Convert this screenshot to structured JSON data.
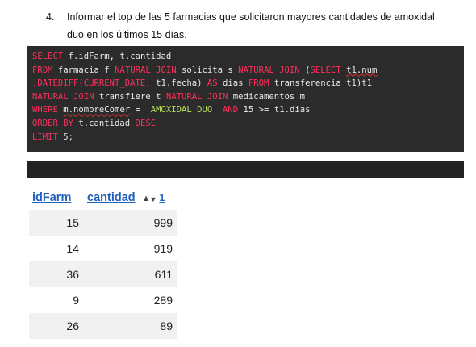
{
  "question": {
    "number": "4.",
    "line1": "Informar el top de las 5 farmacias que solicitaron mayores cantidades de amoxidal",
    "line2": "duo en los últimos 15 días."
  },
  "sql": [
    [
      {
        "t": "SELECT",
        "k": "kw"
      },
      {
        "t": " f.idFarm, t.cantidad"
      }
    ],
    [
      {
        "t": "FROM",
        "k": "kw"
      },
      {
        "t": " farmacia f "
      },
      {
        "t": "NATURAL JOIN",
        "k": "kw"
      },
      {
        "t": " solicita s "
      },
      {
        "t": "NATURAL JOIN",
        "k": "kw"
      },
      {
        "t": " ("
      },
      {
        "t": "SELECT",
        "k": "kw"
      },
      {
        "t": " "
      },
      {
        "t": "t1.num",
        "k": "sq"
      }
    ],
    [
      {
        "t": ",DATEDIFF(CURRENT_DATE,",
        "k": "kw"
      },
      {
        "t": " t1.fecha) "
      },
      {
        "t": "AS",
        "k": "kw"
      },
      {
        "t": " dias "
      },
      {
        "t": "FROM",
        "k": "kw"
      },
      {
        "t": " transferencia t1)t1"
      }
    ],
    [
      {
        "t": "NATURAL JOIN",
        "k": "kw"
      },
      {
        "t": " transfiere t "
      },
      {
        "t": "NATURAL JOIN",
        "k": "kw"
      },
      {
        "t": " medicamentos m"
      }
    ],
    [
      {
        "t": "WHERE",
        "k": "kw"
      },
      {
        "t": " "
      },
      {
        "t": "m.nombreComer",
        "k": "sq"
      },
      {
        "t": " = "
      },
      {
        "t": "'AMOXIDAL DUO'",
        "k": "str"
      },
      {
        "t": " "
      },
      {
        "t": "AND",
        "k": "kw"
      },
      {
        "t": " 15 >= t1.dias"
      }
    ],
    [
      {
        "t": "ORDER BY",
        "k": "kw"
      },
      {
        "t": " t.cantidad "
      },
      {
        "t": "DESC",
        "k": "kw"
      }
    ],
    [
      {
        "t": "LIMIT",
        "k": "kw"
      },
      {
        "t": " 5;"
      }
    ]
  ],
  "results": {
    "columns": [
      "idFarm",
      "cantidad"
    ],
    "sort_order": "1",
    "rows": [
      [
        "15",
        "999"
      ],
      [
        "14",
        "919"
      ],
      [
        "36",
        "611"
      ],
      [
        "9",
        "289"
      ],
      [
        "26",
        "89"
      ]
    ]
  },
  "icons": {
    "sort": "sort-arrows-icon"
  }
}
